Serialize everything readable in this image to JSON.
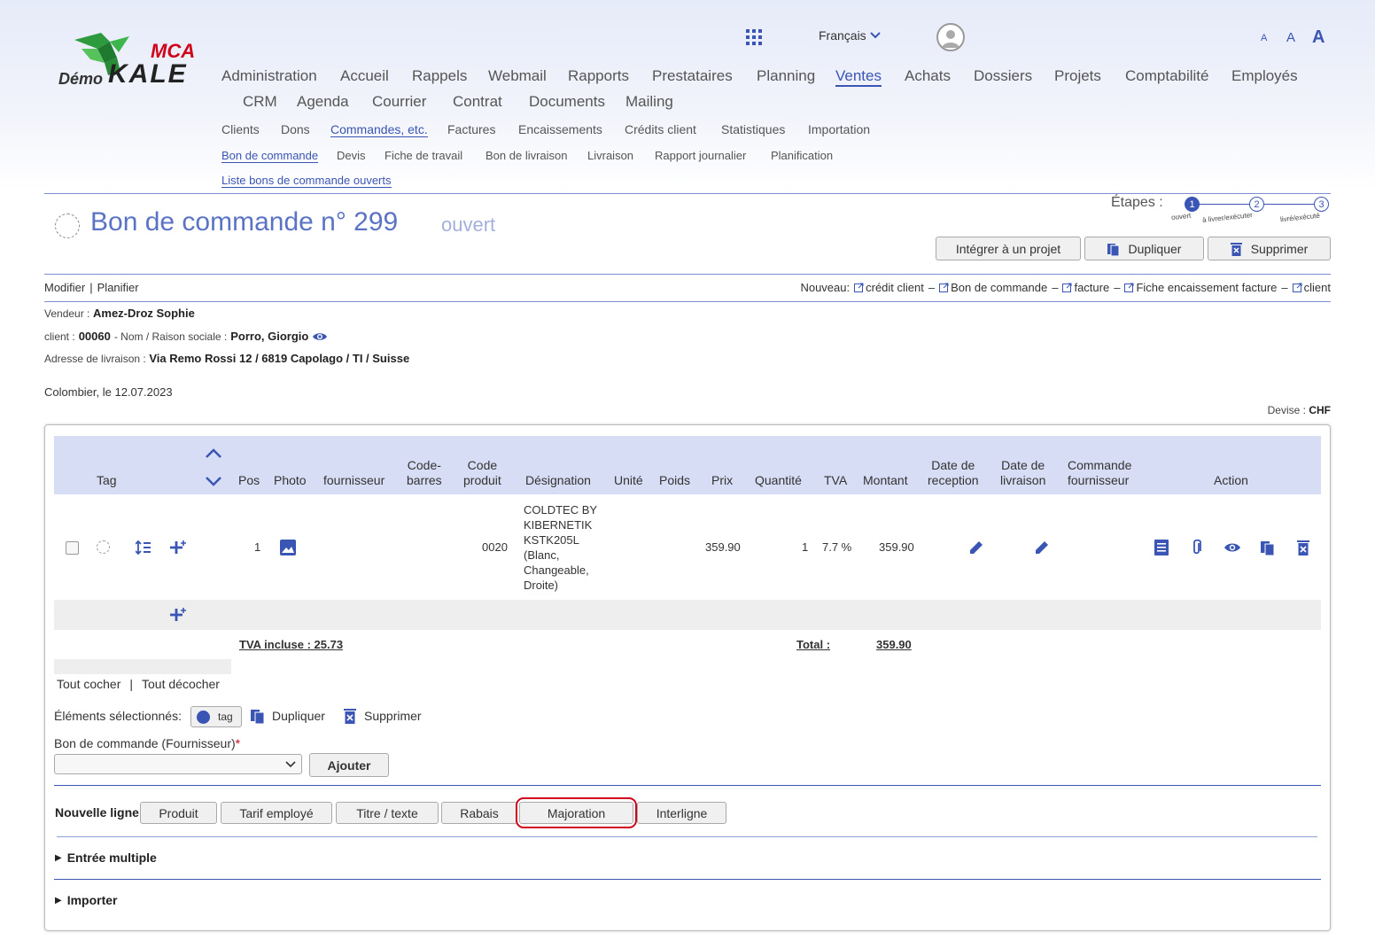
{
  "brand": {
    "demo": "Démo",
    "mca": "MCA",
    "kale": "KALE"
  },
  "top": {
    "language": "Français",
    "font_sizes": [
      "A",
      "A",
      "A"
    ]
  },
  "nav_main": [
    "Administration",
    "Accueil",
    "Rappels",
    "Webmail",
    "Rapports",
    "Prestataires",
    "Planning",
    "Ventes",
    "Achats",
    "Dossiers",
    "Projets",
    "Comptabilité",
    "Employés",
    "CRM",
    "Agenda",
    "Courrier",
    "Contrat",
    "Documents",
    "Mailing"
  ],
  "nav_sub1": [
    "Clients",
    "Dons",
    "Commandes, etc.",
    "Factures",
    "Encaissements",
    "Crédits client",
    "Statistiques",
    "Importation"
  ],
  "nav_sub2": [
    "Bon de commande",
    "Devis",
    "Fiche de travail",
    "Bon de livraison",
    "Livraison",
    "Rapport journalier",
    "Planification"
  ],
  "nav_sub3": "Liste bons de commande ouverts",
  "page": {
    "title": "Bon de commande n° 299",
    "status": "ouvert"
  },
  "steps": {
    "label": "Étapes :",
    "items": [
      {
        "num": "1",
        "label": "ouvert"
      },
      {
        "num": "2",
        "label": "à livrer/exécuter"
      },
      {
        "num": "3",
        "label": "livré/exécuté"
      }
    ]
  },
  "actions": {
    "integrate": "Intégrer à un projet",
    "duplicate": "Dupliquer",
    "delete": "Supprimer"
  },
  "links": {
    "modify": "Modifier",
    "sep": "|",
    "plan": "Planifier",
    "new_label": "Nouveau:",
    "new_items": [
      "crédit client",
      "Bon de commande",
      "facture",
      "Fiche encaissement facture",
      "client"
    ],
    "dash": "–"
  },
  "info": {
    "seller_label": "Vendeur :",
    "seller": "Amez-Droz Sophie",
    "client_label": "client :",
    "client_no": "00060",
    "name_label": "- Nom / Raison sociale :",
    "client_name": "Porro, Giorgio",
    "address_label": "Adresse de livraison :",
    "address": "Via Remo Rossi 12 / 6819 Capolago / TI / Suisse",
    "date_line": "Colombier, le 12.07.2023",
    "currency_label": "Devise :",
    "currency": "CHF"
  },
  "table": {
    "headers": {
      "tag": "Tag",
      "pos": "Pos",
      "photo": "Photo",
      "supplier": "fournisseur",
      "barcode": "Code-\nbarres",
      "code": "Code\nproduit",
      "designation": "Désignation",
      "unit": "Unité",
      "weight": "Poids",
      "price": "Prix",
      "qty": "Quantité",
      "vat": "TVA",
      "amount": "Montant",
      "date_reception": "Date de\nreception",
      "date_delivery": "Date de\nlivraison",
      "supplier_order": "Commande\nfournisseur",
      "action": "Action"
    },
    "row": {
      "pos": "1",
      "code": "0020",
      "designation": "COLDTEC BY\nKIBERNETIK\nKSTK205L\n(Blanc,\nChangeable,\nDroite)",
      "price": "359.90",
      "qty": "1",
      "vat": "7.7 %",
      "amount": "359.90"
    },
    "vat_included": "TVA incluse : 25.73",
    "total_label": "Total :",
    "total": "359.90"
  },
  "selection": {
    "check_all": "Tout cocher",
    "sep": "|",
    "uncheck_all": "Tout décocher",
    "selected_label": "Éléments sélectionnés:",
    "tag": "tag",
    "duplicate": "Dupliquer",
    "delete": "Supprimer"
  },
  "supplier_order": {
    "label": "Bon de commande (Fournisseur)",
    "required": "*",
    "add": "Ajouter"
  },
  "new_line": {
    "label": "Nouvelle ligne",
    "buttons": [
      "Produit",
      "Tarif employé",
      "Titre / texte",
      "Rabais",
      "Majoration",
      "Interligne"
    ]
  },
  "sections": {
    "multiple": "Entrée multiple",
    "import": "Importer"
  },
  "colors": {
    "accent": "#3a55b4",
    "highlight": "#d0021b",
    "header_bg": "#d7ddf4"
  }
}
